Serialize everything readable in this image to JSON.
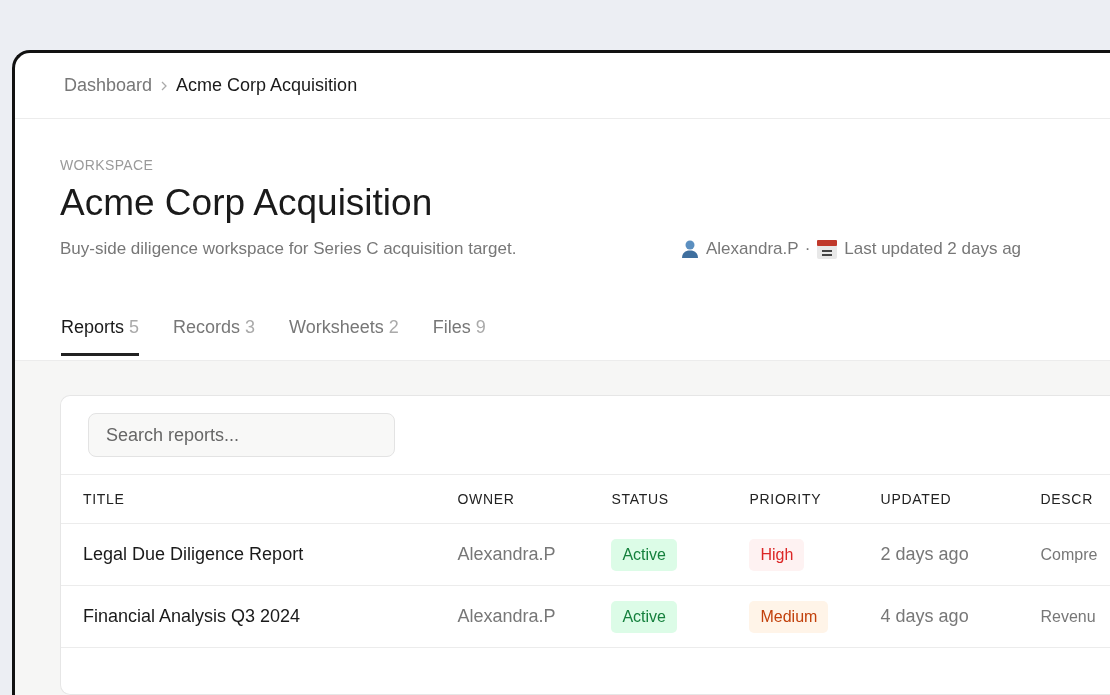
{
  "breadcrumb": [
    {
      "label": "Dashboard",
      "current": false
    },
    {
      "label": "Acme Corp Acquisition",
      "current": true
    }
  ],
  "header": {
    "eyebrow": "WORKSPACE",
    "title": "Acme Corp Acquisition",
    "description": "Buy-side diligence workspace for Series C acquisition target.",
    "owner": "Alexandra.P",
    "separator": "·",
    "updated": "Last updated 2 days ag"
  },
  "tabs": [
    {
      "label": "Reports",
      "count": "5",
      "selected": true
    },
    {
      "label": "Records",
      "count": "3",
      "selected": false
    },
    {
      "label": "Worksheets",
      "count": "2",
      "selected": false
    },
    {
      "label": "Files",
      "count": "9",
      "selected": false
    }
  ],
  "search": {
    "placeholder": "Search reports..."
  },
  "table": {
    "columns": [
      "TITLE",
      "OWNER",
      "STATUS",
      "PRIORITY",
      "UPDATED",
      "DESCR"
    ],
    "rows": [
      {
        "title": "Legal Due Diligence Report",
        "owner": "Alexandra.P",
        "status": "Active",
        "priority": "High",
        "updated": "2 days ago",
        "description": "Compre"
      },
      {
        "title": "Financial Analysis Q3 2024",
        "owner": "Alexandra.P",
        "status": "Active",
        "priority": "Medium",
        "updated": "4 days ago",
        "description": "Revenu"
      }
    ]
  }
}
